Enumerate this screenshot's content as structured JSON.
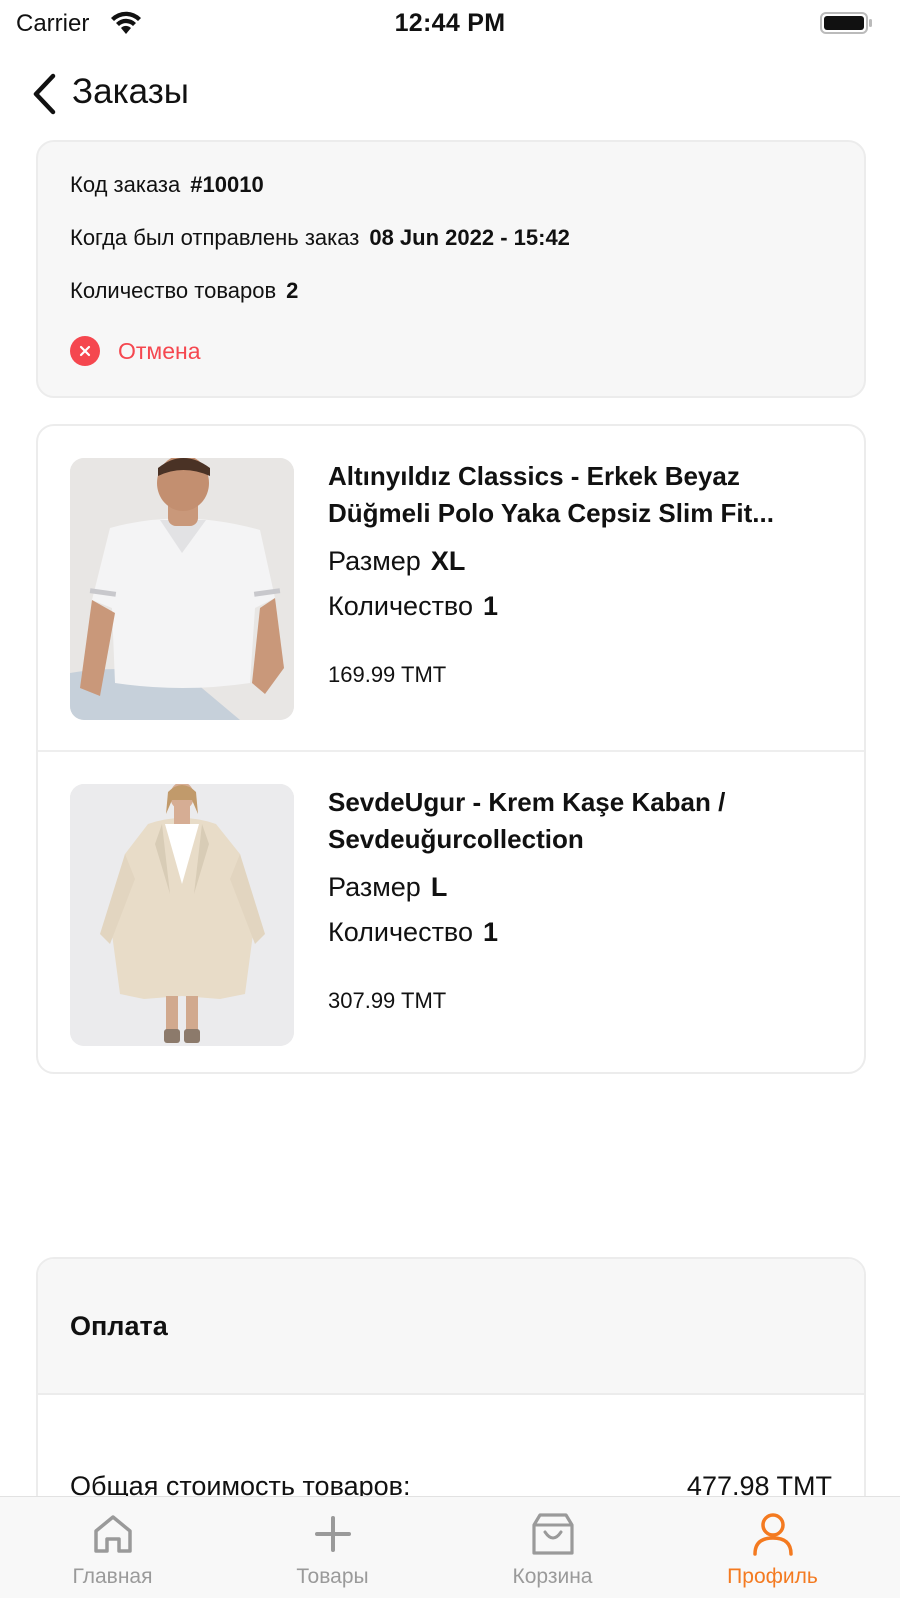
{
  "status_bar": {
    "carrier": "Carrier",
    "time": "12:44 PM"
  },
  "header": {
    "title": "Заказы"
  },
  "order": {
    "code_label": "Код заказа",
    "code_value": "#10010",
    "sent_label": "Когда был отправлень заказ",
    "sent_value": "08 Jun 2022 - 15:42",
    "count_label": "Количество товаров",
    "count_value": "2",
    "status": "Отмена",
    "status_color": "#f5474f"
  },
  "items": [
    {
      "title": "Altınyıldız Classics - Erkek Beyaz Düğmeli Polo Yaka Cepsiz Slim Fit...",
      "size_label": "Размер",
      "size_value": "XL",
      "qty_label": "Количество",
      "qty_value": "1",
      "price": "169.99 TMT"
    },
    {
      "title": "SevdeUgur - Krem Kaşe Kaban / Sevdeuğurcollection",
      "size_label": "Размер",
      "size_value": "L",
      "qty_label": "Количество",
      "qty_value": "1",
      "price": "307.99 TMT"
    }
  ],
  "payment": {
    "title": "Оплата",
    "total_label": "Общая стоимость товаров:",
    "total_value": "477.98 TMT"
  },
  "tabs": [
    {
      "label": "Главная",
      "icon": "home-icon"
    },
    {
      "label": "Товары",
      "icon": "plus-icon"
    },
    {
      "label": "Корзина",
      "icon": "bag-icon"
    },
    {
      "label": "Профиль",
      "icon": "profile-icon",
      "active": true
    }
  ],
  "colors": {
    "accent": "#f47a20",
    "cancel": "#f5474f",
    "tab_inactive": "#9a9a9a"
  }
}
